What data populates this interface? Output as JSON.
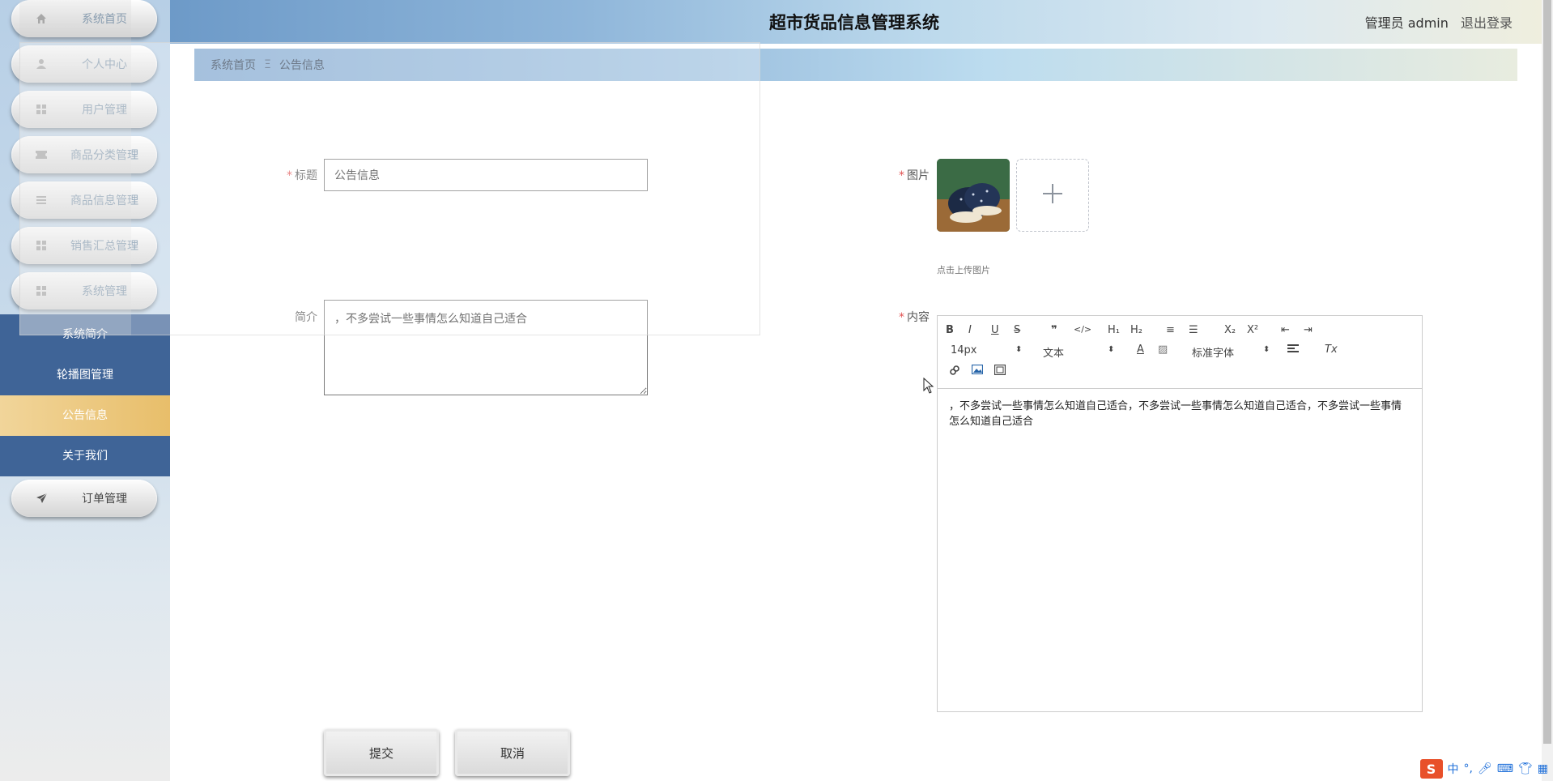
{
  "app": {
    "title": "超市货品信息管理系统",
    "user_text": "管理员 admin",
    "logout_label": "退出登录"
  },
  "breadcrumb": {
    "home": "系统首页",
    "separator": "Ξ",
    "current": "公告信息"
  },
  "sidebar": {
    "items": [
      {
        "label": "系统首页",
        "icon": "home-icon"
      },
      {
        "label": "个人中心",
        "icon": "user-icon"
      },
      {
        "label": "用户管理",
        "icon": "grid-icon"
      },
      {
        "label": "商品分类管理",
        "icon": "ticket-icon"
      },
      {
        "label": "商品信息管理",
        "icon": "list-icon"
      },
      {
        "label": "销售汇总管理",
        "icon": "grid-icon"
      },
      {
        "label": "系统管理",
        "icon": "grid-icon"
      }
    ],
    "submenu": [
      {
        "label": "系统简介",
        "active": false
      },
      {
        "label": "轮播图管理",
        "active": false
      },
      {
        "label": "公告信息",
        "active": true
      },
      {
        "label": "关于我们",
        "active": false
      }
    ],
    "bottom_item": {
      "label": "订单管理",
      "icon": "paper-plane-icon"
    }
  },
  "form": {
    "required_mark": "*",
    "title_label": "标题",
    "title_value": "公告信息",
    "intro_label": "简介",
    "intro_value": "，不多尝试一些事情怎么知道自己适合",
    "image_label": "图片",
    "upload_hint": "点击上传图片",
    "content_label": "内容",
    "submit_label": "提交",
    "cancel_label": "取消"
  },
  "editor": {
    "toolbar": {
      "bold": "B",
      "italic": "I",
      "underline": "U",
      "strike": "S",
      "blockquote": "❞",
      "code": "</>",
      "h1": "H₁",
      "h2": "H₂",
      "ordered_list": "≡",
      "bullet_list": "☰",
      "subscript": "X₂",
      "superscript": "X²",
      "outdent": "⇤",
      "indent": "⇥",
      "font_size": "14px",
      "header_select": "文本",
      "font_family": "标准字体",
      "clear_format": "Tx"
    },
    "content": "，不多尝试一些事情怎么知道自己适合，不多尝试一些事情怎么知道自己适合，不多尝试一些事情怎么知道自己适合"
  },
  "ime": {
    "logo": "S",
    "mode": "中",
    "punct": "°,"
  },
  "colors": {
    "submenu_bg": "#3f6497",
    "active_item": "#e8be6a",
    "required": "#e05252"
  }
}
